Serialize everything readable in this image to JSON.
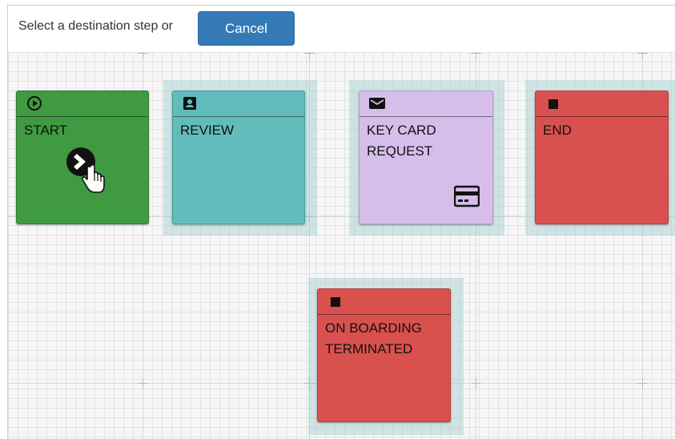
{
  "toolbar": {
    "prompt": "Select a destination step or",
    "cancel_label": "Cancel"
  },
  "colors": {
    "start": "#3f9a42",
    "review": "#62bcbc",
    "keycard": "#d6bdea",
    "end": "#d9514e",
    "halo": "#a0cdcd",
    "button": "#337ab7"
  },
  "nodes": {
    "start": {
      "label": "START",
      "icon": "play-circle-icon"
    },
    "review": {
      "label": "REVIEW",
      "icon": "contact-card-icon"
    },
    "keycard": {
      "label": "KEY CARD\nREQUEST",
      "icon": "envelope-icon",
      "badge_icon": "credit-card-icon"
    },
    "end": {
      "label": "END",
      "icon": "stop-square-icon"
    },
    "terminated": {
      "label": "ON BOARDING\nTERMINATED",
      "icon": "stop-square-icon"
    }
  },
  "cursor": {
    "icon": "hand-pointer-icon",
    "connector_icon": "chevron-right-circle-icon"
  }
}
